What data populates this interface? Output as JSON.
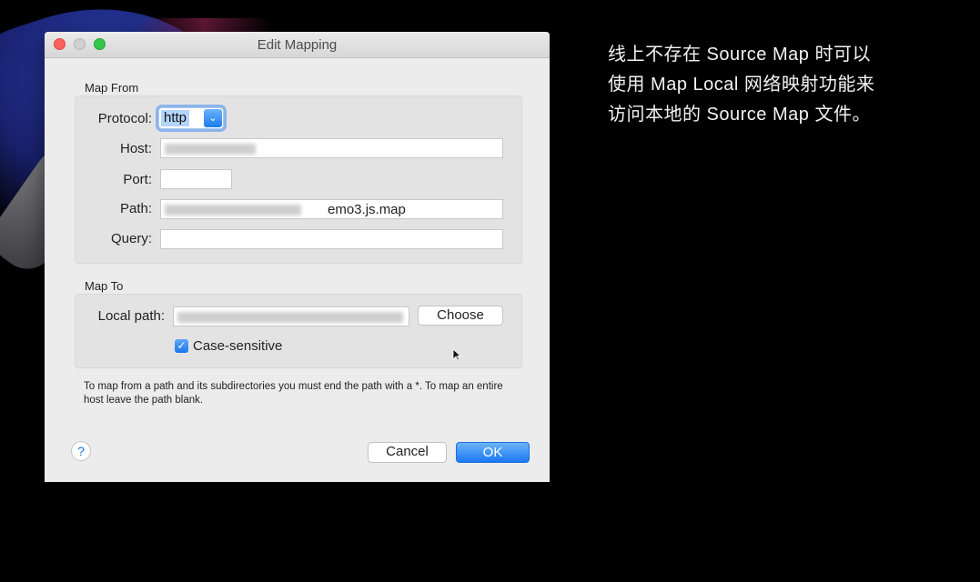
{
  "dialog": {
    "title": "Edit Mapping",
    "map_from": {
      "section_label": "Map From",
      "protocol_label": "Protocol:",
      "protocol_value": "http",
      "host_label": "Host:",
      "host_value": "",
      "port_label": "Port:",
      "port_value": "",
      "path_label": "Path:",
      "path_value_visible": "emo3.js.map",
      "query_label": "Query:",
      "query_value": ""
    },
    "map_to": {
      "section_label": "Map To",
      "local_path_label": "Local path:",
      "local_path_value": "",
      "choose_button": "Choose",
      "case_sensitive_label": "Case-sensitive",
      "case_sensitive_checked": true
    },
    "help_text": "To map from a path and its subdirectories you must end the path with a *. To map an entire host leave the path blank.",
    "help_button": "?",
    "cancel_button": "Cancel",
    "ok_button": "OK"
  },
  "caption": {
    "line1": "线上不存在 Source Map 时可以",
    "line2": "使用 Map Local 网络映射功能来",
    "line3": "访问本地的 Source Map 文件。"
  },
  "colors": {
    "accent": "#1a77ef",
    "window_bg": "#ececec",
    "background": "#000000"
  }
}
